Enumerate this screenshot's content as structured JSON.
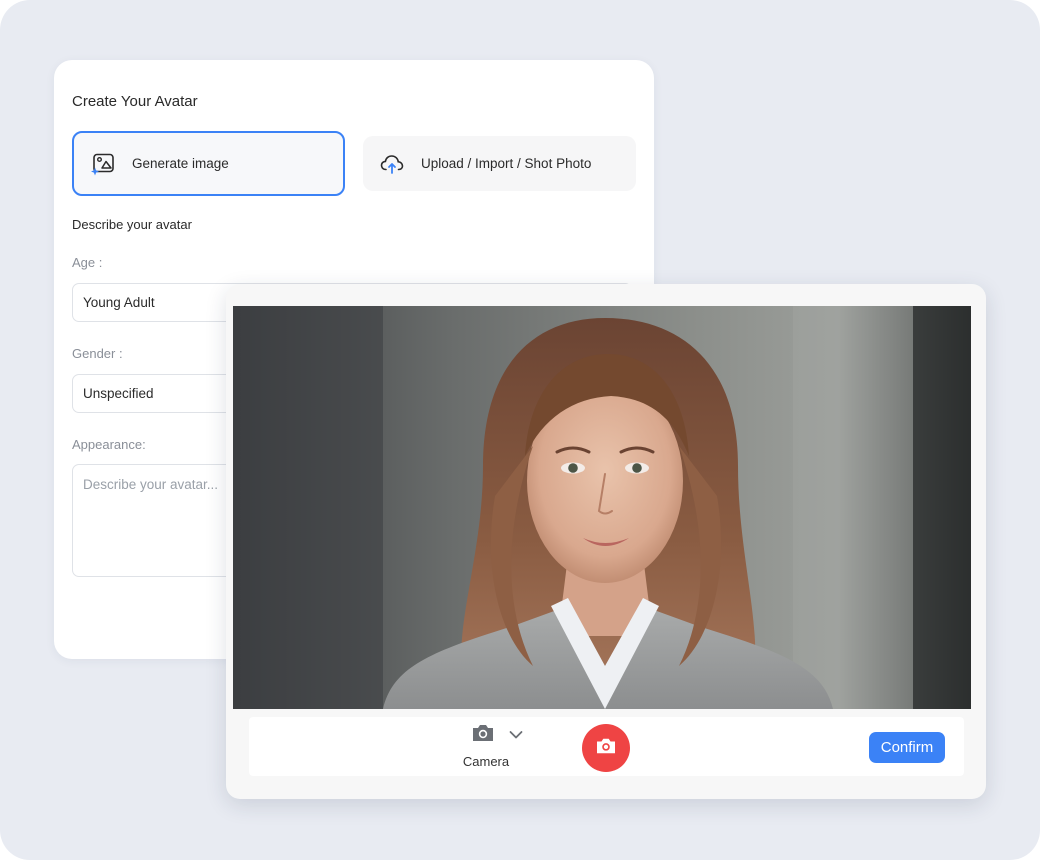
{
  "card": {
    "title": "Create Your Avatar",
    "modes": [
      {
        "label": "Generate image",
        "icon": "image-sparkle-icon",
        "selected": true
      },
      {
        "label": "Upload / Import / Shot Photo",
        "icon": "cloud-upload-icon",
        "selected": false
      }
    ],
    "section_label": "Describe your avatar",
    "fields": {
      "age": {
        "label": "Age :",
        "value": "Young Adult"
      },
      "gender": {
        "label": "Gender :",
        "value": "Unspecified"
      },
      "appearance": {
        "label": "Appearance:",
        "placeholder": "Describe your avatar..."
      }
    }
  },
  "camera": {
    "source_label": "Camera",
    "source_icon": "camera-icon",
    "shutter_icon": "camera-icon",
    "confirm_label": "Confirm"
  },
  "colors": {
    "accent": "#3b82f6",
    "shutter": "#ef4444",
    "background": "#e8ebf2"
  }
}
